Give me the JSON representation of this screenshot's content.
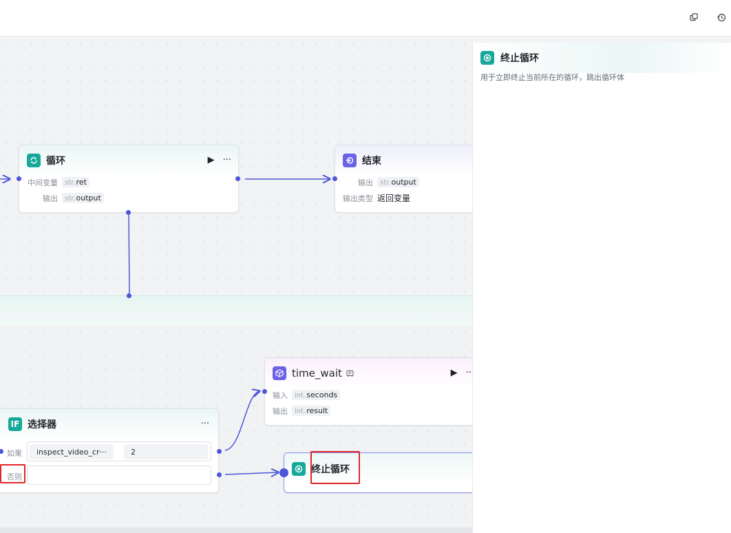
{
  "toolbar": {
    "icons": [
      "copy-icon",
      "history-icon"
    ]
  },
  "nodes": {
    "loop": {
      "title": "循环",
      "icon": "loop-icon",
      "rows": [
        {
          "label": "中间变量",
          "type": "str.",
          "value": "ret"
        },
        {
          "label": "输出",
          "type": "str.",
          "value": "output"
        }
      ],
      "run": "▶",
      "more": "···"
    },
    "end": {
      "title": "结束",
      "icon": "end-icon",
      "rows": [
        {
          "label": "输出",
          "type": "str.",
          "value": "output"
        },
        {
          "label": "输出类型",
          "value": "返回变量"
        }
      ]
    },
    "time_wait": {
      "title": "time_wait",
      "icon": "cube-icon",
      "rows": [
        {
          "label": "输入",
          "type": "int.",
          "value": "seconds"
        },
        {
          "label": "输出",
          "type": "int.",
          "value": "result"
        }
      ],
      "run": "▶",
      "more": "···"
    },
    "selector": {
      "title": "选择器",
      "icon_text": "IF",
      "more": "···",
      "if_label": "如果",
      "if_var": "inspect_video_cr···",
      "if_value": "2",
      "else_label": "否则"
    },
    "break_loop": {
      "title": "终止循环",
      "icon": "break-loop-icon"
    }
  },
  "panel": {
    "title": "终止循环",
    "description": "用于立即终止当前所在的循环，跳出循环体"
  },
  "colors": {
    "accent_teal": "#17a89a",
    "accent_purple": "#6b63e6",
    "edge": "#4c56d9",
    "highlight": "#e02424"
  }
}
